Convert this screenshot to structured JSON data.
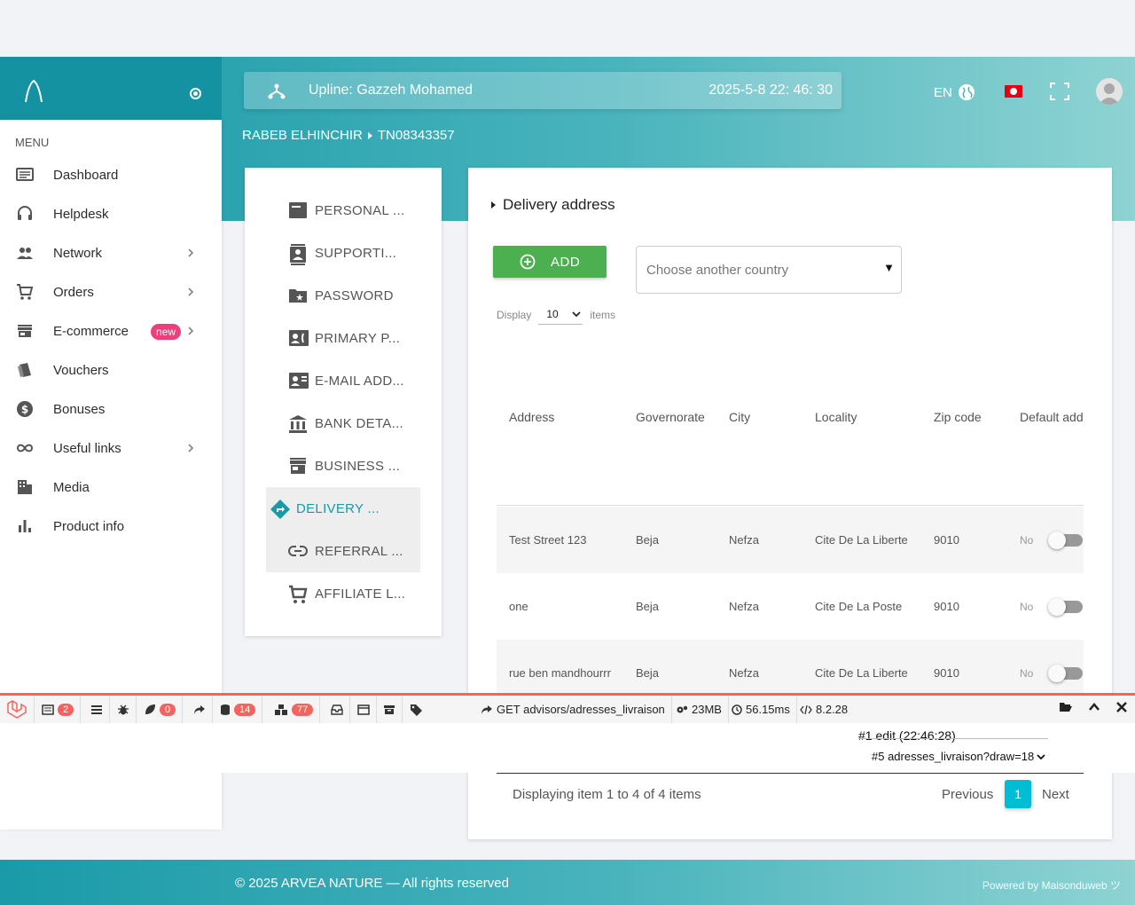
{
  "header": {
    "upline_label": "Upline: Gazzeh Mohamed",
    "datetime": "2025-5-8 22: 46: 30",
    "language": "EN"
  },
  "breadcrumb": {
    "name": "RABEB ELHINCHIR",
    "id": "TN08343357"
  },
  "sidebar": {
    "menu_title": "MENU",
    "items": [
      {
        "label": "Dashboard",
        "icon": "dashboard-icon"
      },
      {
        "label": "Helpdesk",
        "icon": "headset-icon"
      },
      {
        "label": "Network",
        "icon": "people-icon"
      },
      {
        "label": "Orders",
        "icon": "cart-icon"
      },
      {
        "label": "E-commerce",
        "icon": "store-icon",
        "badge": "new"
      },
      {
        "label": "Vouchers",
        "icon": "voucher-icon"
      },
      {
        "label": "Bonuses",
        "icon": "dollar-icon"
      },
      {
        "label": "Useful links",
        "icon": "infinity-icon"
      },
      {
        "label": "Media",
        "icon": "media-icon"
      },
      {
        "label": "Product info",
        "icon": "bar-chart-icon"
      }
    ]
  },
  "tabs": [
    {
      "label": "PERSONAL ...",
      "icon": "card-icon"
    },
    {
      "label": "SUPPORTI...",
      "icon": "contact-icon"
    },
    {
      "label": "PASSWORD",
      "icon": "folder-star-icon"
    },
    {
      "label": "PRIMARY P...",
      "icon": "contact-phone-icon"
    },
    {
      "label": "E-MAIL ADD...",
      "icon": "contact-mail-icon"
    },
    {
      "label": "BANK DETA...",
      "icon": "bank-icon"
    },
    {
      "label": "BUSINESS ...",
      "icon": "store-icon"
    },
    {
      "label": "DELIVERY ...",
      "icon": "directions-icon"
    },
    {
      "label": "REFERRAL ...",
      "icon": "link-icon"
    },
    {
      "label": "AFFILIATE L...",
      "icon": "cart-icon"
    }
  ],
  "main": {
    "section_title": "Delivery address",
    "add_label": "ADD",
    "country_placeholder": "Choose another country",
    "display_label": "Display",
    "display_value": "10",
    "items_label": "items",
    "columns": [
      "Address",
      "Governorate",
      "City",
      "Locality",
      "Zip code",
      "Default add"
    ],
    "rows": [
      {
        "address": "Test Street 123",
        "governorate": "Beja",
        "city": "Nefza",
        "locality": "Cite De La Liberte",
        "zip": "9010",
        "default": "No"
      },
      {
        "address": "one",
        "governorate": "Beja",
        "city": "Nefza",
        "locality": "Cite De La Poste",
        "zip": "9010",
        "default": "No"
      },
      {
        "address": "rue ben mandhourrr",
        "governorate": "Beja",
        "city": "Nefza",
        "locality": "Cite De La Liberte",
        "zip": "9010",
        "default": "No"
      }
    ],
    "page_info": "Displaying item 1 to 4 of 4 items",
    "prev_label": "Previous",
    "current_page": "1",
    "next_label": "Next"
  },
  "debugbar": {
    "messages_count": "2",
    "exceptions_count": "0",
    "queries_count": "14",
    "models_count": "77",
    "route": "GET advisors/adresses_livraison",
    "memory": "23MB",
    "time": "56.15ms",
    "php_version": "8.2.28",
    "request_label": "#1 edit (22:46:28)",
    "request_select": "#5 adresses_livraison?draw=18"
  },
  "footer": {
    "copyright": "© 2025 ARVEA NATURE — All rights reserved",
    "powered": "Powered by Maisonduweb ツ"
  },
  "colors": {
    "teal": "#1a9aa8",
    "active_tab": "#1a9aa8",
    "add_green": "#4caf50",
    "page_cyan": "#00bcd4",
    "new_badge": "#ec407a",
    "debug_red": "#f4645f"
  }
}
